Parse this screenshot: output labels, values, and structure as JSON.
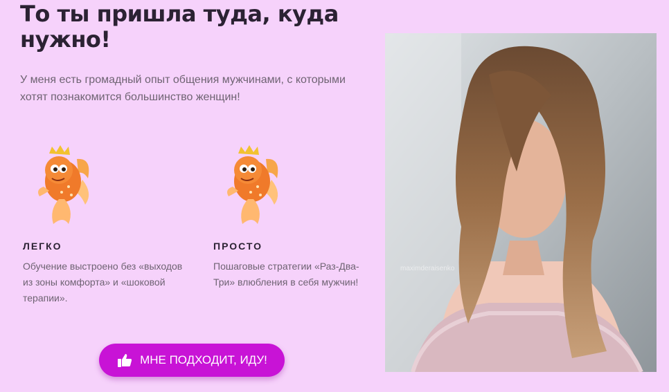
{
  "page": {
    "heading": "То ты пришла туда, куда нужно!",
    "intro": "У меня есть громадный опыт общения мужчинами, с которыми хотят познакомится большинство женщин!"
  },
  "features": [
    {
      "icon": "goldfish-icon",
      "title": "ЛЕГКО",
      "text": "Обучение выстроено без «выходов из зоны комфорта» и «шоковой терапии»."
    },
    {
      "icon": "goldfish-icon",
      "title": "ПРОСТО",
      "text": "Пошаговые стратегии «Раз-Два-Три» влюбления в себя мужчин!"
    }
  ],
  "cta": {
    "icon": "thumbs-up-icon",
    "label": "МНЕ ПОДХОДИТ, ИДУ!"
  },
  "photo": {
    "watermark": "maximderaisenko"
  },
  "colors": {
    "background": "#f6d2fb",
    "accent": "#c813d6",
    "heading": "#2b2233",
    "body_text": "#6e6372"
  }
}
